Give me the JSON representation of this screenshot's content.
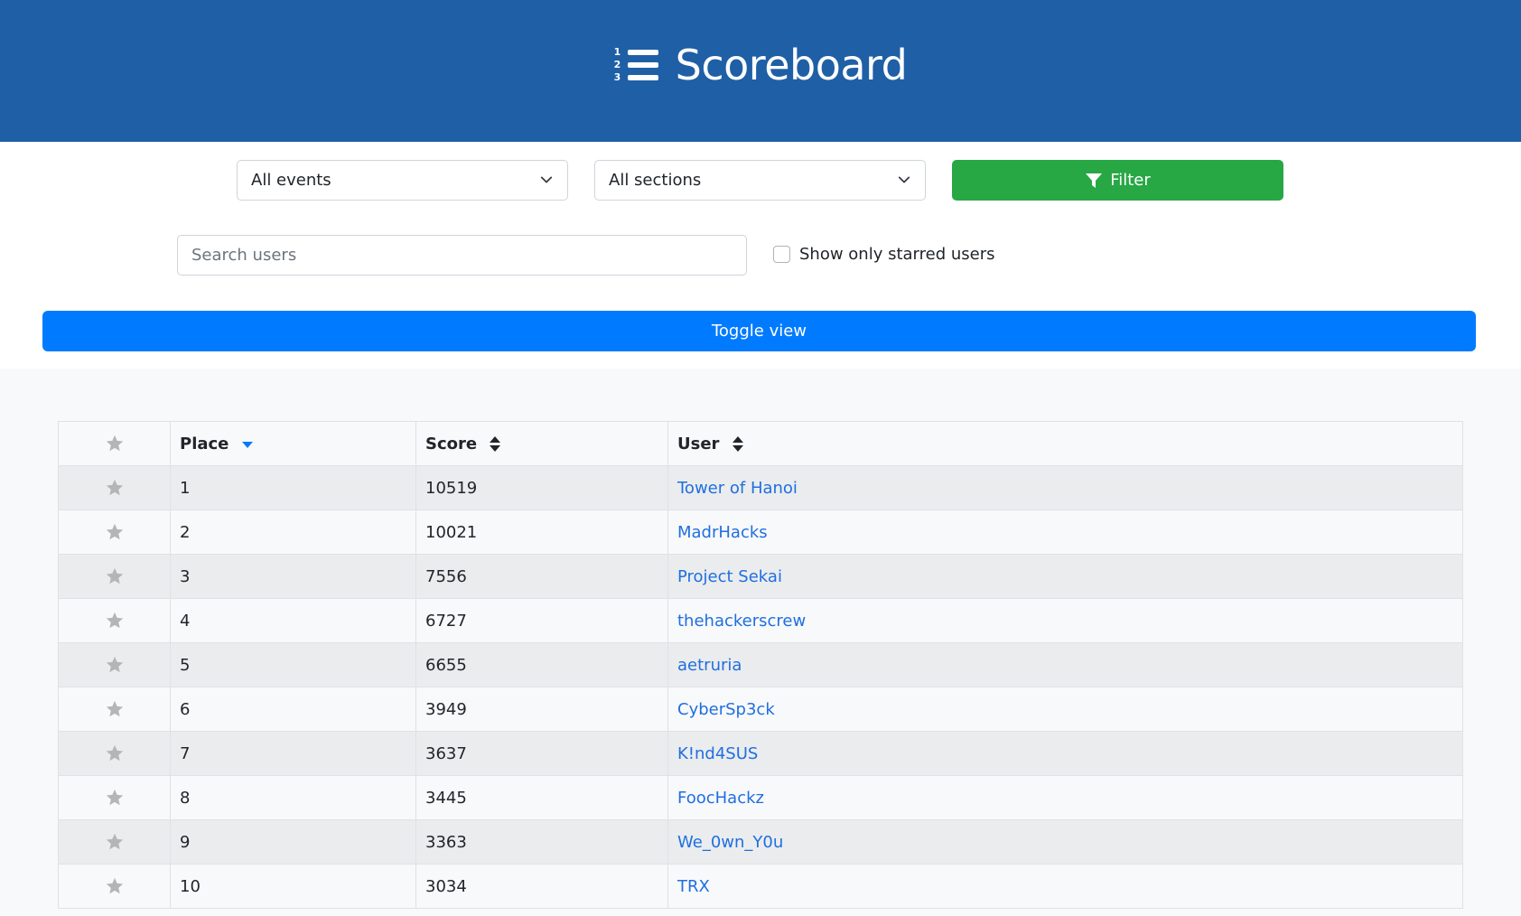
{
  "header": {
    "title": "Scoreboard",
    "icon": "list-ol-icon",
    "icon_numbers": [
      "1",
      "2",
      "3"
    ]
  },
  "filters": {
    "event_select": {
      "value": "All events",
      "icon": "chevron-down-icon"
    },
    "section_select": {
      "value": "All sections",
      "icon": "chevron-down-icon"
    },
    "filter_button": {
      "label": "Filter",
      "icon": "filter-icon"
    },
    "search": {
      "placeholder": "Search users",
      "value": ""
    },
    "starred_checkbox": {
      "label": "Show only starred users",
      "checked": false
    },
    "toggle_button": {
      "label": "Toggle view"
    }
  },
  "colors": {
    "header_bg": "#1f5fa6",
    "filter_button": "#28a745",
    "toggle_button": "#007bff",
    "link": "#1f6fe0",
    "sort_active": "#007bff",
    "star_inactive": "#b5b5b5"
  },
  "table": {
    "columns": [
      {
        "key": "star",
        "label": "",
        "icon": "star-icon"
      },
      {
        "key": "place",
        "label": "Place",
        "sort": "desc-active"
      },
      {
        "key": "score",
        "label": "Score",
        "sort": "sortable"
      },
      {
        "key": "user",
        "label": "User",
        "sort": "sortable"
      }
    ],
    "rows": [
      {
        "place": "1",
        "score": "10519",
        "user": "Tower of Hanoi",
        "starred": false
      },
      {
        "place": "2",
        "score": "10021",
        "user": "MadrHacks",
        "starred": false
      },
      {
        "place": "3",
        "score": "7556",
        "user": "Project Sekai",
        "starred": false
      },
      {
        "place": "4",
        "score": "6727",
        "user": "thehackerscrew",
        "starred": false
      },
      {
        "place": "5",
        "score": "6655",
        "user": "aetruria",
        "starred": false
      },
      {
        "place": "6",
        "score": "3949",
        "user": "CyberSp3ck",
        "starred": false
      },
      {
        "place": "7",
        "score": "3637",
        "user": "K!nd4SUS",
        "starred": false
      },
      {
        "place": "8",
        "score": "3445",
        "user": "FoocHackz",
        "starred": false
      },
      {
        "place": "9",
        "score": "3363",
        "user": "We_0wn_Y0u",
        "starred": false
      },
      {
        "place": "10",
        "score": "3034",
        "user": "TRX",
        "starred": false
      }
    ]
  }
}
